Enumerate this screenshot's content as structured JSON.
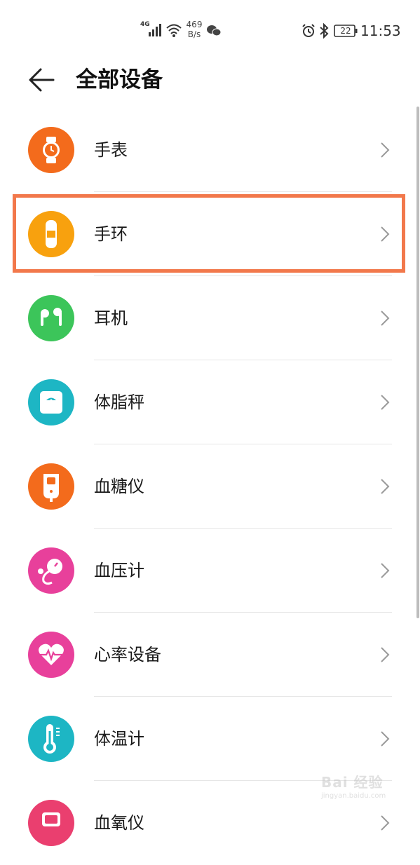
{
  "status_bar": {
    "network": "4G",
    "speed_value": "469",
    "speed_unit": "B/s",
    "battery": "22",
    "time": "11:53"
  },
  "header": {
    "title": "全部设备"
  },
  "devices": [
    {
      "label": "手表",
      "icon": "watch-icon",
      "color": "#f36b1c"
    },
    {
      "label": "手环",
      "icon": "band-icon",
      "color": "#f8a10e"
    },
    {
      "label": "耳机",
      "icon": "earphones-icon",
      "color": "#3cc55a"
    },
    {
      "label": "体脂秤",
      "icon": "scale-icon",
      "color": "#1db6c4"
    },
    {
      "label": "血糖仪",
      "icon": "glucometer-icon",
      "color": "#f36b1c"
    },
    {
      "label": "血压计",
      "icon": "blood-pressure-icon",
      "color": "#e8409b"
    },
    {
      "label": "心率设备",
      "icon": "heart-rate-icon",
      "color": "#e8409b"
    },
    {
      "label": "体温计",
      "icon": "thermometer-icon",
      "color": "#1db6c4"
    },
    {
      "label": "血氧仪",
      "icon": "oximeter-icon",
      "color": "#ea3f6f"
    }
  ],
  "highlight_color": "#f2784b",
  "watermark": {
    "text": "Bai 经验",
    "sub": "jingyan.baidu.com"
  }
}
